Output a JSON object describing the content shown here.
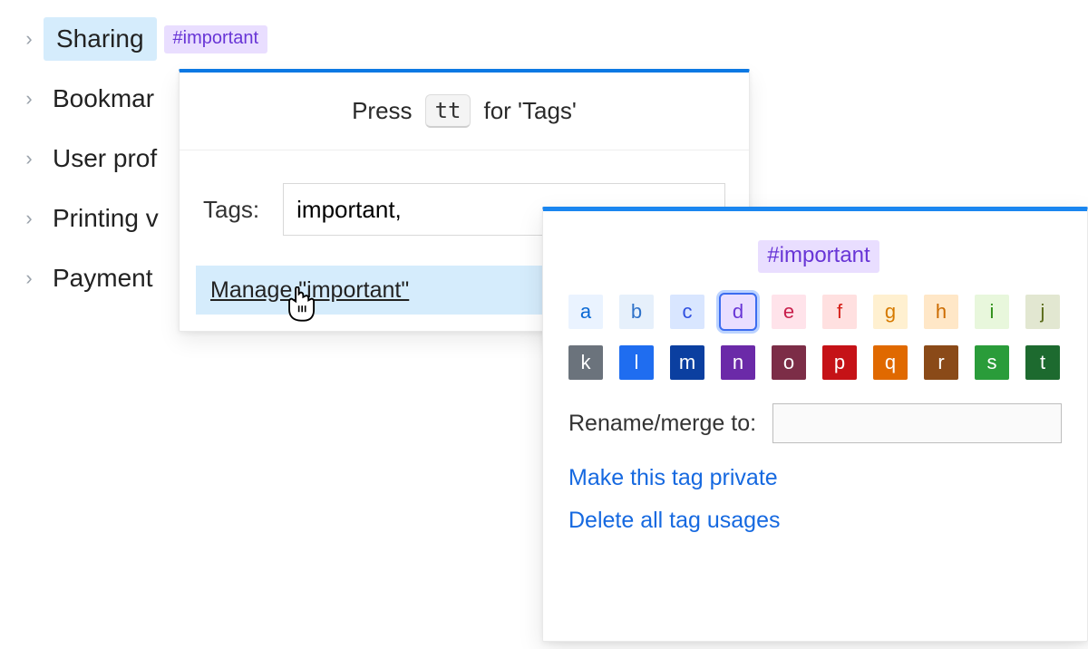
{
  "outline": {
    "items": [
      {
        "label": "Sharing",
        "selected": true,
        "tag": "#important"
      },
      {
        "label": "Bookmar"
      },
      {
        "label": "User prof"
      },
      {
        "label": "Printing v"
      },
      {
        "label": "Payment"
      }
    ]
  },
  "tags_popover": {
    "hint_prefix": "Press",
    "hint_key": "tt",
    "hint_suffix": "for 'Tags'",
    "tags_label": "Tags:",
    "tags_value": "important,",
    "manage_label": "Manage \"important\""
  },
  "manage_panel": {
    "tag_display": "#important",
    "swatches": [
      {
        "k": "a",
        "bg": "#eaf3ff",
        "fg": "#0b69d4",
        "sel": false
      },
      {
        "k": "b",
        "bg": "#e6f0fb",
        "fg": "#2f72c9",
        "sel": false
      },
      {
        "k": "c",
        "bg": "#d9e6ff",
        "fg": "#2f4fe0",
        "sel": false
      },
      {
        "k": "d",
        "bg": "#e9deff",
        "fg": "#6835d6",
        "sel": true
      },
      {
        "k": "e",
        "bg": "#ffe3ea",
        "fg": "#c81f4b",
        "sel": false
      },
      {
        "k": "f",
        "bg": "#ffe0e0",
        "fg": "#d6221a",
        "sel": false
      },
      {
        "k": "g",
        "bg": "#fff0d0",
        "fg": "#d67a00",
        "sel": false
      },
      {
        "k": "h",
        "bg": "#ffe7c7",
        "fg": "#cc6b00",
        "sel": false
      },
      {
        "k": "i",
        "bg": "#e8f7dc",
        "fg": "#2f8f1a",
        "sel": false
      },
      {
        "k": "j",
        "bg": "#e2e7d1",
        "fg": "#5a6b1a",
        "sel": false
      },
      {
        "k": "k",
        "bg": "#6b737c",
        "fg": "#ffffff",
        "sel": false
      },
      {
        "k": "l",
        "bg": "#1f6df0",
        "fg": "#ffffff",
        "sel": false
      },
      {
        "k": "m",
        "bg": "#0b3fa0",
        "fg": "#ffffff",
        "sel": false
      },
      {
        "k": "n",
        "bg": "#6b2aa8",
        "fg": "#ffffff",
        "sel": false
      },
      {
        "k": "o",
        "bg": "#7c2d47",
        "fg": "#ffffff",
        "sel": false
      },
      {
        "k": "p",
        "bg": "#c51217",
        "fg": "#ffffff",
        "sel": false
      },
      {
        "k": "q",
        "bg": "#e06900",
        "fg": "#ffffff",
        "sel": false
      },
      {
        "k": "r",
        "bg": "#8a4a18",
        "fg": "#ffffff",
        "sel": false
      },
      {
        "k": "s",
        "bg": "#2a9c3a",
        "fg": "#ffffff",
        "sel": false
      },
      {
        "k": "t",
        "bg": "#1d6a2f",
        "fg": "#ffffff",
        "sel": false
      }
    ],
    "rename_label": "Rename/merge to:",
    "rename_value": "",
    "make_private_label": "Make this tag private",
    "delete_all_label": "Delete all tag usages"
  }
}
